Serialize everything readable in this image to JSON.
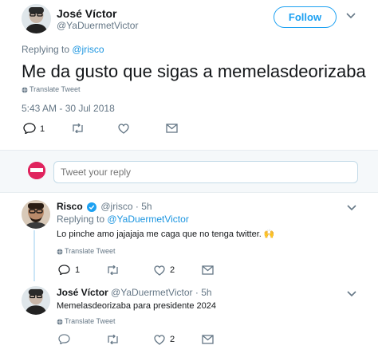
{
  "main_tweet": {
    "author_name": "José Víctor",
    "author_handle": "@YaDuermetVictor",
    "follow_label": "Follow",
    "replying_to_prefix": "Replying to ",
    "replying_to_handle": "@jrisco",
    "text": "Me da gusto que sigas a memelasdeorizaba",
    "translate_label": "Translate Tweet",
    "timestamp": "5:43 AM - 30 Jul 2018",
    "reply_count": "1"
  },
  "reply_box": {
    "placeholder": "Tweet your reply"
  },
  "replies": [
    {
      "author_name": "Risco",
      "author_handle": "@jrisco",
      "time": "5h",
      "replying_to_prefix": "Replying to ",
      "replying_to_handle": "@YaDuermetVictor",
      "text": "Lo pinche amo jajajaja me caga que no tenga twitter. 🙌",
      "translate_label": "Translate Tweet",
      "reply_count": "1",
      "like_count": "2"
    },
    {
      "author_name": "José Víctor",
      "author_handle": "@YaDuermetVictor",
      "time": "5h",
      "text": "Memelasdeorizaba para presidente 2024",
      "translate_label": "Translate Tweet",
      "like_count": "2"
    }
  ],
  "colors": {
    "accent": "#1da1f2",
    "link": "#1b95e0",
    "muted": "#657786",
    "verified": "#1da1f2"
  }
}
